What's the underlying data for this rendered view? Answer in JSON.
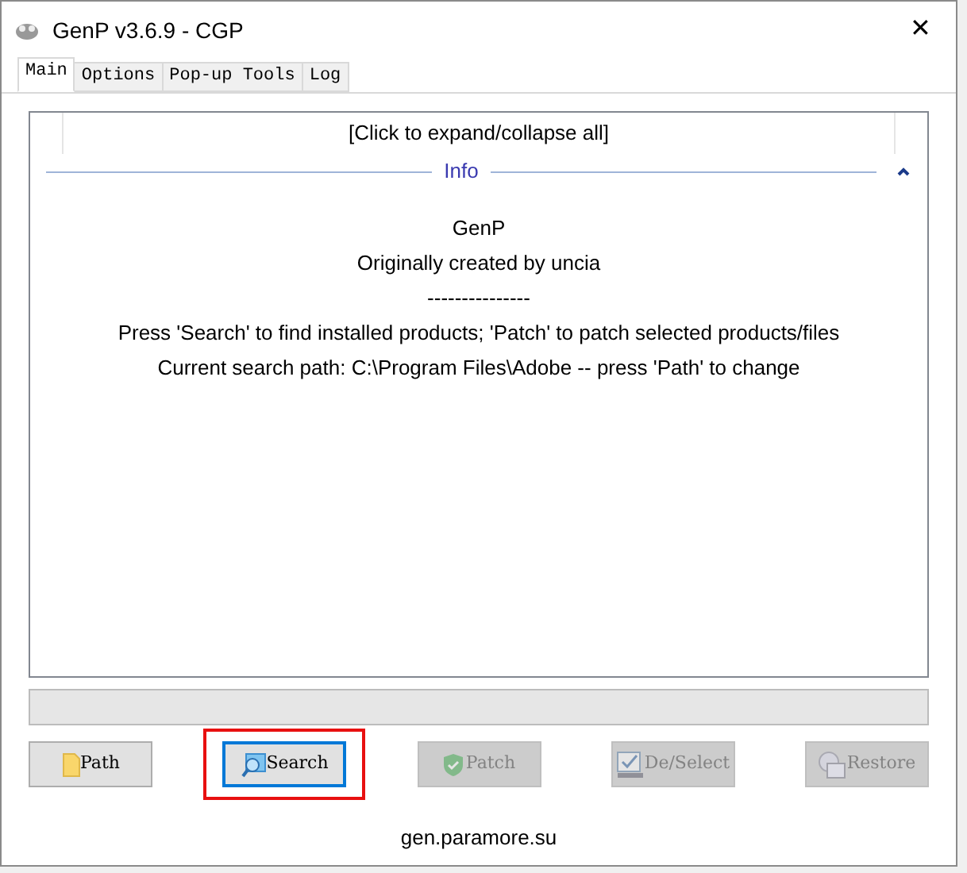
{
  "window": {
    "title": "GenP v3.6.9 - CGP",
    "close": "✕"
  },
  "tabs": [
    {
      "label": "Main",
      "selected": true
    },
    {
      "label": "Options",
      "selected": false
    },
    {
      "label": "Pop-up Tools",
      "selected": false
    },
    {
      "label": "Log",
      "selected": false
    }
  ],
  "tree": {
    "header": "[Click to expand/collapse all]",
    "section": {
      "title": "Info",
      "expanded": true,
      "lines": [
        "GenP",
        "Originally created by uncia",
        "---------------",
        "Press 'Search' to find installed products; 'Patch' to patch selected products/files",
        "Current search path: C:\\Program Files\\Adobe -- press 'Path' to change"
      ]
    }
  },
  "progress": {
    "level": 0
  },
  "buttons": [
    {
      "label": "Path",
      "kind": "folder",
      "disabled": false,
      "focused": false,
      "highlighted": false
    },
    {
      "label": "Search",
      "kind": "search",
      "disabled": false,
      "focused": true,
      "highlighted": true
    },
    {
      "label": "Patch",
      "kind": "shield",
      "disabled": true,
      "focused": false,
      "highlighted": false
    },
    {
      "label": "De/Select",
      "kind": "check",
      "disabled": true,
      "focused": false,
      "highlighted": false
    },
    {
      "label": "Restore",
      "kind": "restore",
      "disabled": true,
      "focused": false,
      "highlighted": false
    }
  ],
  "footer": "gen.paramore.su"
}
